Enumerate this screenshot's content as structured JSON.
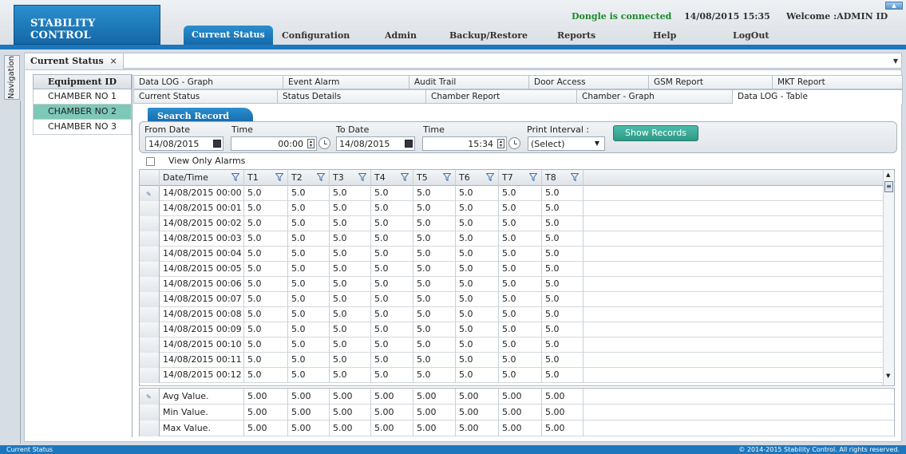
{
  "header": {
    "logo": "STABILITY CONTROL",
    "dongle_status": "Dongle is connected",
    "datetime": "14/08/2015 15:35",
    "welcome": "Welcome :ADMIN ID",
    "nav": [
      "Current Status",
      "Configuration",
      "Admin",
      "Backup/Restore",
      "Reports",
      "Help",
      "LogOut"
    ],
    "active_nav": "Current Status"
  },
  "sidebar": {
    "navigation_label": "Navigation"
  },
  "document_tab": {
    "label": "Current Status",
    "close": "×"
  },
  "equipment": {
    "header": "Equipment ID",
    "items": [
      "CHAMBER NO 1",
      "CHAMBER NO 2",
      "CHAMBER NO 3"
    ],
    "selected": "CHAMBER NO 2"
  },
  "subtabs_top": [
    "Data LOG - Graph",
    "Event Alarm",
    "Audit Trail",
    "Door Access",
    "GSM Report",
    "MKT Report"
  ],
  "subtabs_bottom": [
    "Current Status",
    "Status Details",
    "Chamber Report",
    "Chamber - Graph",
    "Data LOG - Table"
  ],
  "active_subtab": "Data LOG - Table",
  "search": {
    "title": "Search Record",
    "from_date_label": "From Date",
    "from_date": "14/08/2015",
    "from_time_label": "Time",
    "from_time": "00:00",
    "to_date_label": "To Date",
    "to_date": "14/08/2015",
    "to_time_label": "Time",
    "to_time": "15:34",
    "interval_label": "Print Interval :",
    "interval_value": "(Select)",
    "show_button": "Show Records"
  },
  "alarms": {
    "label": "View Only Alarms",
    "checked": false
  },
  "grid": {
    "columns": [
      "Date/Time",
      "T1",
      "T2",
      "T3",
      "T4",
      "T5",
      "T6",
      "T7",
      "T8"
    ],
    "rows": [
      [
        "14/08/2015 00:00",
        "5.0",
        "5.0",
        "5.0",
        "5.0",
        "5.0",
        "5.0",
        "5.0",
        "5.0"
      ],
      [
        "14/08/2015 00:01",
        "5.0",
        "5.0",
        "5.0",
        "5.0",
        "5.0",
        "5.0",
        "5.0",
        "5.0"
      ],
      [
        "14/08/2015 00:02",
        "5.0",
        "5.0",
        "5.0",
        "5.0",
        "5.0",
        "5.0",
        "5.0",
        "5.0"
      ],
      [
        "14/08/2015 00:03",
        "5.0",
        "5.0",
        "5.0",
        "5.0",
        "5.0",
        "5.0",
        "5.0",
        "5.0"
      ],
      [
        "14/08/2015 00:04",
        "5.0",
        "5.0",
        "5.0",
        "5.0",
        "5.0",
        "5.0",
        "5.0",
        "5.0"
      ],
      [
        "14/08/2015 00:05",
        "5.0",
        "5.0",
        "5.0",
        "5.0",
        "5.0",
        "5.0",
        "5.0",
        "5.0"
      ],
      [
        "14/08/2015 00:06",
        "5.0",
        "5.0",
        "5.0",
        "5.0",
        "5.0",
        "5.0",
        "5.0",
        "5.0"
      ],
      [
        "14/08/2015 00:07",
        "5.0",
        "5.0",
        "5.0",
        "5.0",
        "5.0",
        "5.0",
        "5.0",
        "5.0"
      ],
      [
        "14/08/2015 00:08",
        "5.0",
        "5.0",
        "5.0",
        "5.0",
        "5.0",
        "5.0",
        "5.0",
        "5.0"
      ],
      [
        "14/08/2015 00:09",
        "5.0",
        "5.0",
        "5.0",
        "5.0",
        "5.0",
        "5.0",
        "5.0",
        "5.0"
      ],
      [
        "14/08/2015 00:10",
        "5.0",
        "5.0",
        "5.0",
        "5.0",
        "5.0",
        "5.0",
        "5.0",
        "5.0"
      ],
      [
        "14/08/2015 00:11",
        "5.0",
        "5.0",
        "5.0",
        "5.0",
        "5.0",
        "5.0",
        "5.0",
        "5.0"
      ],
      [
        "14/08/2015 00:12",
        "5.0",
        "5.0",
        "5.0",
        "5.0",
        "5.0",
        "5.0",
        "5.0",
        "5.0"
      ]
    ]
  },
  "summary": {
    "rows": [
      [
        "Avg Value.",
        "5.00",
        "5.00",
        "5.00",
        "5.00",
        "5.00",
        "5.00",
        "5.00",
        "5.00"
      ],
      [
        "Min Value.",
        "5.00",
        "5.00",
        "5.00",
        "5.00",
        "5.00",
        "5.00",
        "5.00",
        "5.00"
      ],
      [
        "Max Value.",
        "5.00",
        "5.00",
        "5.00",
        "5.00",
        "5.00",
        "5.00",
        "5.00",
        "5.00"
      ]
    ]
  },
  "footer": {
    "left": "Current Status",
    "right": "© 2014-2015 Stability Control. All rights reserved."
  },
  "colors": {
    "brand_blue": "#1e77bc",
    "connected_green": "#1a8a2a",
    "selected_row": "#7ec8b8",
    "button_teal": "#2e9886"
  }
}
